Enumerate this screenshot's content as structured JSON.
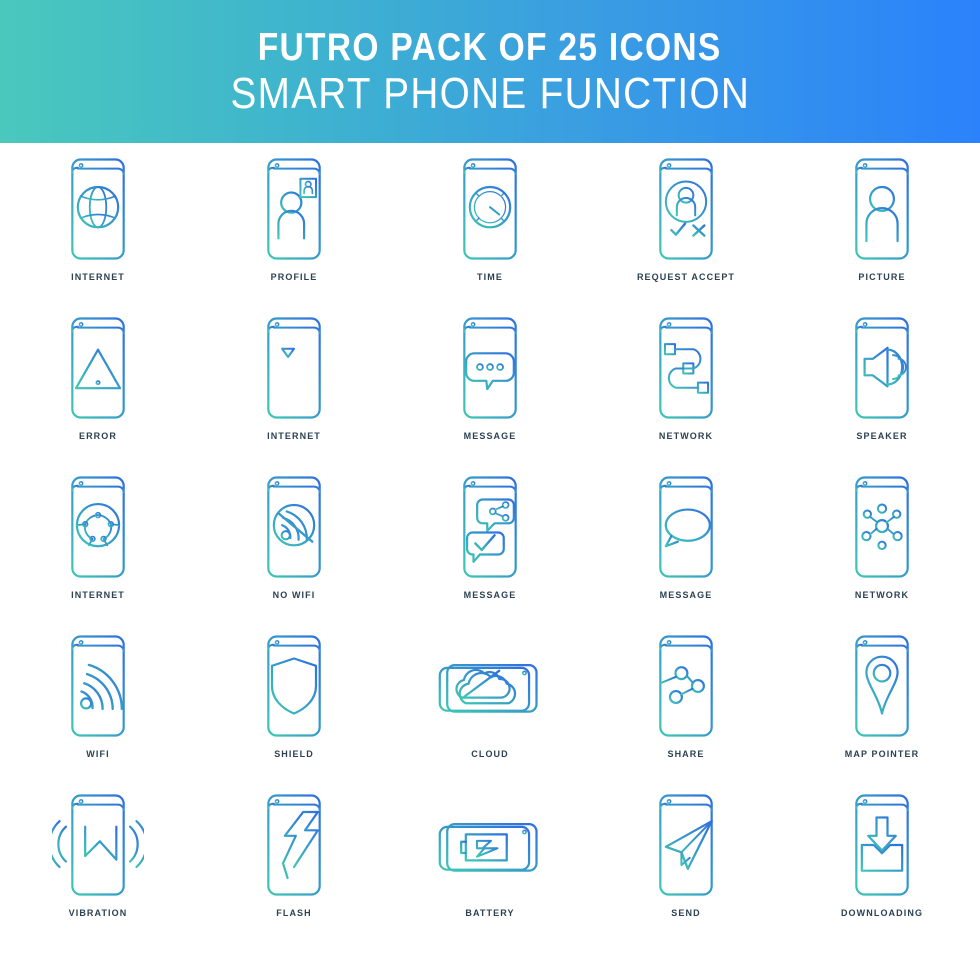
{
  "header": {
    "title": "FUTRO PACK OF 25 ICONS",
    "subtitle": "SMART PHONE FUNCTION",
    "gradient_start": "#4ac8bd",
    "gradient_end": "#2b82fb",
    "text_color": "#ffffff"
  },
  "style": {
    "icon_gradient_start": "#3ec7b4",
    "icon_gradient_end": "#2f6fe0",
    "label_color": "#2c4152",
    "background": "#ffffff"
  },
  "icons": [
    {
      "label": "INTERNET",
      "glyph": "globe-grid",
      "orientation": "portrait"
    },
    {
      "label": "PROFILE",
      "glyph": "person-id-badge",
      "orientation": "portrait"
    },
    {
      "label": "TIME",
      "glyph": "clock",
      "orientation": "portrait"
    },
    {
      "label": "REQUEST ACCEPT",
      "glyph": "person-check-cross",
      "orientation": "portrait"
    },
    {
      "label": "PICTURE",
      "glyph": "person",
      "orientation": "portrait"
    },
    {
      "label": "ERROR",
      "glyph": "warning-triangle",
      "orientation": "portrait"
    },
    {
      "label": "INTERNET",
      "glyph": "signal-bars",
      "orientation": "portrait"
    },
    {
      "label": "MESSAGE",
      "glyph": "chat-bubble-dots",
      "orientation": "portrait"
    },
    {
      "label": "NETWORK",
      "glyph": "node-wires",
      "orientation": "portrait"
    },
    {
      "label": "SPEAKER",
      "glyph": "speaker-waves",
      "orientation": "portrait"
    },
    {
      "label": "INTERNET",
      "glyph": "globe-nodes",
      "orientation": "portrait"
    },
    {
      "label": "NO WIFI",
      "glyph": "wifi-off",
      "orientation": "portrait"
    },
    {
      "label": "MESSAGE",
      "glyph": "share-check-bubble",
      "orientation": "portrait"
    },
    {
      "label": "MESSAGE",
      "glyph": "chat-bubble-lines",
      "orientation": "portrait"
    },
    {
      "label": "NETWORK",
      "glyph": "hub-spokes",
      "orientation": "portrait"
    },
    {
      "label": "WIFI",
      "glyph": "wifi",
      "orientation": "portrait"
    },
    {
      "label": "SHIELD",
      "glyph": "shield",
      "orientation": "portrait"
    },
    {
      "label": "CLOUD",
      "glyph": "cloud",
      "orientation": "landscape"
    },
    {
      "label": "SHARE",
      "glyph": "share-nodes",
      "orientation": "portrait"
    },
    {
      "label": "MAP POINTER",
      "glyph": "map-pin",
      "orientation": "portrait"
    },
    {
      "label": "VIBRATION",
      "glyph": "vibration-waves",
      "orientation": "portrait"
    },
    {
      "label": "FLASH",
      "glyph": "lightning-crack",
      "orientation": "portrait"
    },
    {
      "label": "BATTERY",
      "glyph": "battery-bolt",
      "orientation": "landscape"
    },
    {
      "label": "SEND",
      "glyph": "paper-plane",
      "orientation": "portrait"
    },
    {
      "label": "DOWNLOADING",
      "glyph": "download-tray",
      "orientation": "portrait"
    }
  ]
}
